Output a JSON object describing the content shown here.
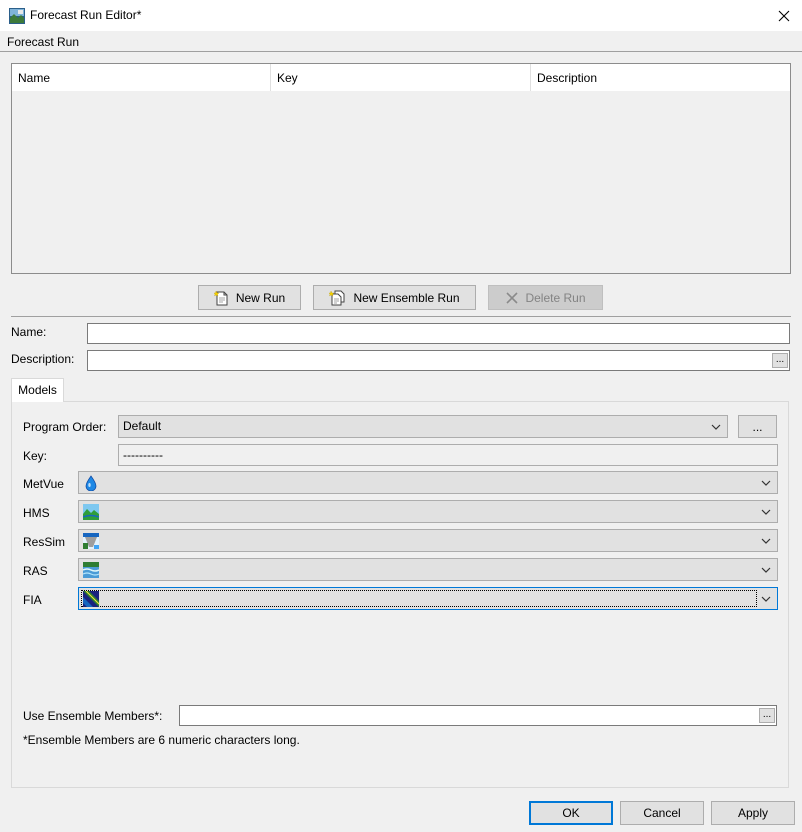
{
  "window": {
    "title": "Forecast Run Editor*",
    "close_glyph": "✕"
  },
  "menu": {
    "label": "Forecast Run"
  },
  "table": {
    "columns": [
      "Name",
      "Key",
      "Description"
    ],
    "rows": []
  },
  "buttons": {
    "new_run": "New Run",
    "new_ensemble_run": "New Ensemble Run",
    "delete_run": "Delete Run",
    "ok": "OK",
    "cancel": "Cancel",
    "apply": "Apply",
    "ellipsis": "..."
  },
  "form": {
    "name_label": "Name:",
    "name_value": "",
    "description_label": "Description:",
    "description_value": ""
  },
  "tabs": [
    {
      "label": "Models",
      "active": true
    }
  ],
  "models": {
    "program_order_label": "Program Order:",
    "program_order_value": "Default",
    "key_label": "Key:",
    "key_value": "----------",
    "rows": [
      {
        "label": "MetVue",
        "icon": "water-drop-icon"
      },
      {
        "label": "HMS",
        "icon": "hms-landscape-icon"
      },
      {
        "label": "ResSim",
        "icon": "ressim-dam-icon"
      },
      {
        "label": "RAS",
        "icon": "ras-river-icon"
      },
      {
        "label": "FIA",
        "icon": "fia-map-icon",
        "focused": true
      }
    ],
    "ensemble_label": "Use Ensemble Members*:",
    "ensemble_value": "",
    "ensemble_note": "*Ensemble Members are 6 numeric characters long."
  },
  "colors": {
    "focus_blue": "#0078d7",
    "button_face": "#e1e1e1",
    "window_bg": "#f0f0f0"
  }
}
